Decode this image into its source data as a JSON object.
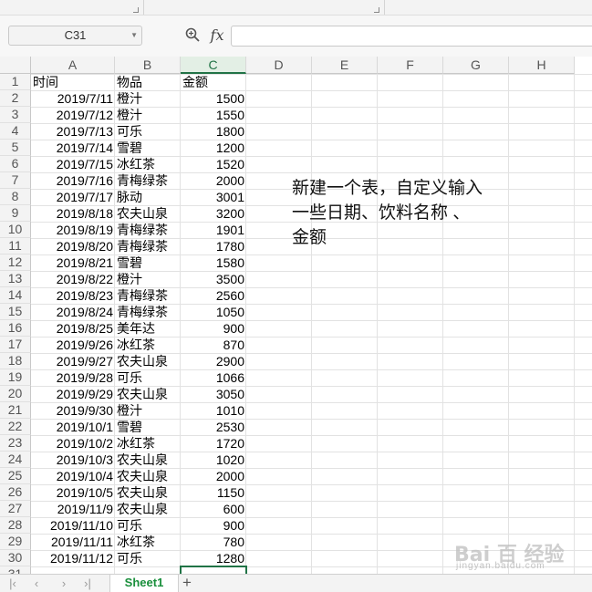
{
  "formula_bar": {
    "name_box": "C31",
    "fx_label": "fx"
  },
  "columns": [
    "A",
    "B",
    "C",
    "D",
    "E",
    "F",
    "G",
    "H"
  ],
  "rows": [
    {
      "n": "1",
      "a": "时间",
      "b": "物品",
      "c": "金额"
    },
    {
      "n": "2",
      "a": "2019/7/11",
      "b": "橙汁",
      "c": "1500"
    },
    {
      "n": "3",
      "a": "2019/7/12",
      "b": "橙汁",
      "c": "1550"
    },
    {
      "n": "4",
      "a": "2019/7/13",
      "b": "可乐",
      "c": "1800"
    },
    {
      "n": "5",
      "a": "2019/7/14",
      "b": "雪碧",
      "c": "1200"
    },
    {
      "n": "6",
      "a": "2019/7/15",
      "b": "冰红茶",
      "c": "1520"
    },
    {
      "n": "7",
      "a": "2019/7/16",
      "b": "青梅绿茶",
      "c": "2000"
    },
    {
      "n": "8",
      "a": "2019/7/17",
      "b": "脉动",
      "c": "3001"
    },
    {
      "n": "9",
      "a": "2019/8/18",
      "b": "农夫山泉",
      "c": "3200"
    },
    {
      "n": "10",
      "a": "2019/8/19",
      "b": "青梅绿茶",
      "c": "1901"
    },
    {
      "n": "11",
      "a": "2019/8/20",
      "b": "青梅绿茶",
      "c": "1780"
    },
    {
      "n": "12",
      "a": "2019/8/21",
      "b": "雪碧",
      "c": "1580"
    },
    {
      "n": "13",
      "a": "2019/8/22",
      "b": "橙汁",
      "c": "3500"
    },
    {
      "n": "14",
      "a": "2019/8/23",
      "b": "青梅绿茶",
      "c": "2560"
    },
    {
      "n": "15",
      "a": "2019/8/24",
      "b": "青梅绿茶",
      "c": "1050"
    },
    {
      "n": "16",
      "a": "2019/8/25",
      "b": "美年达",
      "c": "900"
    },
    {
      "n": "17",
      "a": "2019/9/26",
      "b": "冰红茶",
      "c": "870"
    },
    {
      "n": "18",
      "a": "2019/9/27",
      "b": "农夫山泉",
      "c": "2900"
    },
    {
      "n": "19",
      "a": "2019/9/28",
      "b": "可乐",
      "c": "1066"
    },
    {
      "n": "20",
      "a": "2019/9/29",
      "b": "农夫山泉",
      "c": "3050"
    },
    {
      "n": "21",
      "a": "2019/9/30",
      "b": "橙汁",
      "c": "1010"
    },
    {
      "n": "22",
      "a": "2019/10/1",
      "b": "雪碧",
      "c": "2530"
    },
    {
      "n": "23",
      "a": "2019/10/2",
      "b": "冰红茶",
      "c": "1720"
    },
    {
      "n": "24",
      "a": "2019/10/3",
      "b": "农夫山泉",
      "c": "1020"
    },
    {
      "n": "25",
      "a": "2019/10/4",
      "b": "农夫山泉",
      "c": "2000"
    },
    {
      "n": "26",
      "a": "2019/10/5",
      "b": "农夫山泉",
      "c": "1150"
    },
    {
      "n": "27",
      "a": "2019/11/9",
      "b": "农夫山泉",
      "c": "600"
    },
    {
      "n": "28",
      "a": "2019/11/10",
      "b": "可乐",
      "c": "900"
    },
    {
      "n": "29",
      "a": "2019/11/11",
      "b": "冰红茶",
      "c": "780"
    },
    {
      "n": "30",
      "a": "2019/11/12",
      "b": "可乐",
      "c": "1280"
    },
    {
      "n": "31",
      "a": "",
      "b": "",
      "c": ""
    }
  ],
  "note": {
    "lines": [
      "新建一个表，自定义输入",
      "一些日期、饮料名称 、",
      "金额"
    ]
  },
  "sheet_tabs": {
    "active": "Sheet1",
    "add_label": "+"
  },
  "watermark": {
    "text": "Bai 百 经验",
    "sub": "jingyan.baidu.com"
  },
  "accent_color": "#217346"
}
